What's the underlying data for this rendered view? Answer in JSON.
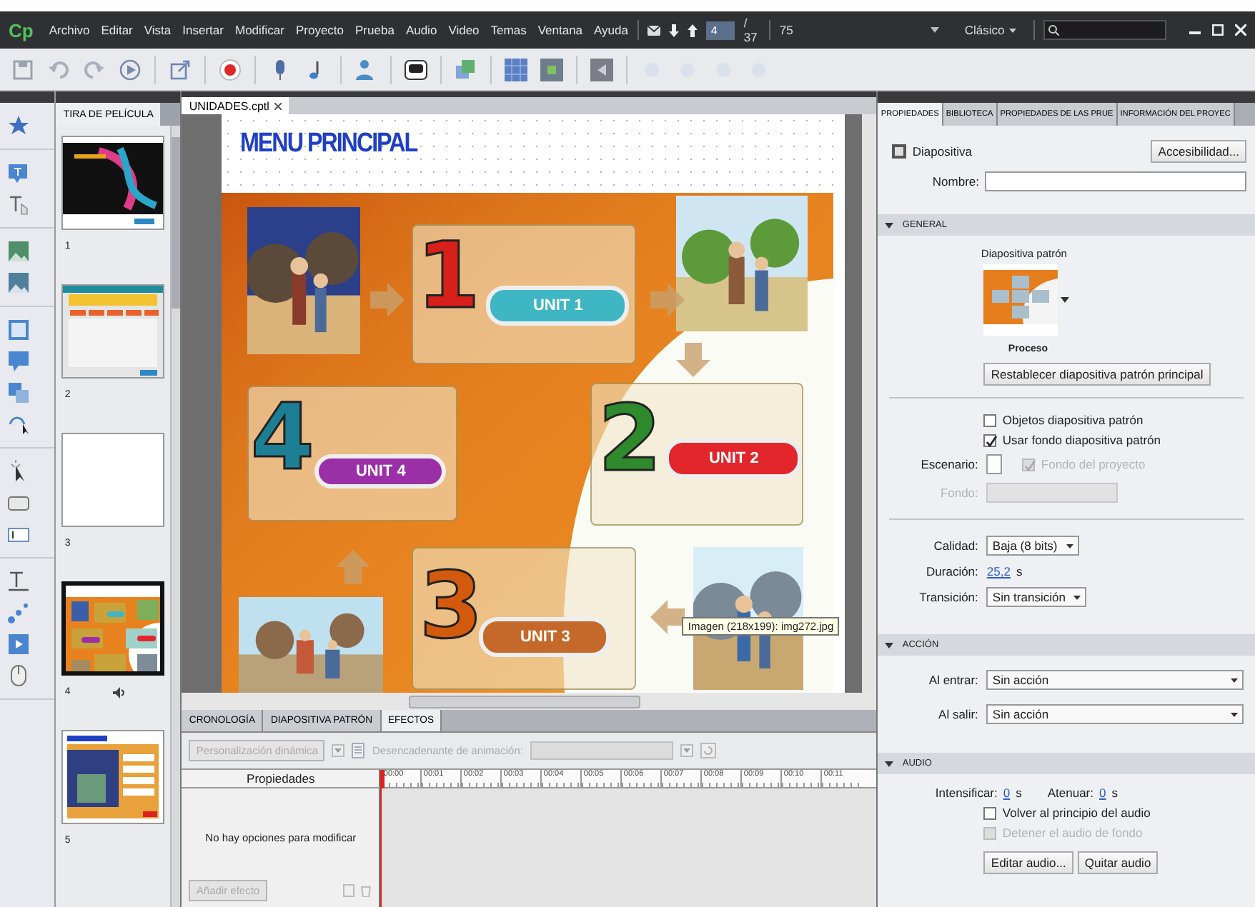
{
  "app": {
    "logo": "Cp"
  },
  "menu": [
    {
      "label": "Archivo"
    },
    {
      "label": "Editar"
    },
    {
      "label": "Vista"
    },
    {
      "label": "Insertar"
    },
    {
      "label": "Modificar"
    },
    {
      "label": "Proyecto"
    },
    {
      "label": "Prueba"
    },
    {
      "label": "Audio"
    },
    {
      "label": "Video"
    },
    {
      "label": "Temas"
    },
    {
      "label": "Ventana"
    },
    {
      "label": "Ayuda"
    }
  ],
  "navigation": {
    "slide": "4",
    "total": "/ 37",
    "zoom": "75"
  },
  "workspace": {
    "label": "Clásico"
  },
  "filmstrip": {
    "title": "TIRA DE PELÍCULA",
    "slides": [
      {
        "number": "1",
        "kind": "dark",
        "selected": false,
        "audio": false
      },
      {
        "number": "2",
        "kind": "menu",
        "selected": false,
        "audio": false
      },
      {
        "number": "3",
        "kind": "blank",
        "selected": false,
        "audio": false
      },
      {
        "number": "4",
        "kind": "units",
        "selected": true,
        "audio": true
      },
      {
        "number": "5",
        "kind": "unit-page",
        "selected": false,
        "audio": false
      }
    ]
  },
  "document_tab": {
    "label": "UNIDADES.cptl"
  },
  "slide": {
    "title": "MENU PRINCIPAL",
    "units": [
      {
        "label": "UNIT 1",
        "number": "1",
        "color": "#3eb6c4"
      },
      {
        "label": "UNIT 4",
        "number": "4",
        "color": "#9a2fa8"
      },
      {
        "label": "UNIT 2",
        "number": "2",
        "color": "#e3262c"
      },
      {
        "label": "UNIT 3",
        "number": "3",
        "color": "#c5692a"
      }
    ],
    "tooltip": "Imagen (218x199): img272.jpg"
  },
  "bottom_panel": {
    "tabs": [
      {
        "label": "CRONOLOGÍA",
        "selected": false
      },
      {
        "label": "DIAPOSITIVA PATRÓN",
        "selected": false
      },
      {
        "label": "EFECTOS",
        "selected": true
      }
    ],
    "custom_button": {
      "label": "Personalización dinámica",
      "disabled": true
    },
    "trigger_label": {
      "label": "Desencadenante de animación:",
      "disabled": true
    },
    "properties_header": "Propiedades",
    "empty_message": "No hay opciones para modificar",
    "add_effect": {
      "label": "Añadir efecto",
      "disabled": true
    },
    "ticks": [
      "00:00",
      "00:01",
      "00:02",
      "00:03",
      "00:04",
      "00:05",
      "00:06",
      "00:07",
      "00:08",
      "00:09",
      "00:10",
      "00:11"
    ]
  },
  "properties": {
    "tabs": [
      {
        "label": "PROPIEDADES",
        "selected": true
      },
      {
        "label": "BIBLIOTECA",
        "selected": false
      },
      {
        "label": "PROPIEDADES DE LAS PRUE",
        "selected": false
      },
      {
        "label": "INFORMACIÓN DEL PROYEC",
        "selected": false
      }
    ],
    "object_type": "Diapositiva",
    "accessibility_button": "Accesibilidad...",
    "name_label": "Nombre:",
    "sections": [
      {
        "title": "GENERAL",
        "expanded": true,
        "master_label": "Diapositiva patrón",
        "master_name": "Proceso",
        "reset_button": "Restablecer diapositiva patrón principal",
        "checkboxes": [
          {
            "label": "Objetos diapositiva patrón",
            "checked": false,
            "disabled": false
          },
          {
            "label": "Usar fondo diapositiva patrón",
            "checked": true,
            "disabled": false
          }
        ],
        "stage_label": "Escenario:",
        "project_bg": {
          "label": "Fondo del proyecto",
          "checked": true,
          "disabled": true
        },
        "background_label": "Fondo:",
        "quality_label": "Calidad:",
        "quality": "Baja (8 bits)",
        "duration_label": "Duración:",
        "duration": "25,2",
        "duration_unit": "s",
        "transition_label": "Transición:",
        "transition": "Sin transición"
      },
      {
        "title": "ACCIÓN",
        "expanded": true,
        "fields": [
          {
            "label": "Al entrar:",
            "value": "Sin acción"
          },
          {
            "label": "Al salir:",
            "value": "Sin acción"
          }
        ]
      },
      {
        "title": "AUDIO",
        "expanded": true,
        "fade_in_label": "Intensificar:",
        "fade_in": "0",
        "fade_in_unit": "s",
        "fade_out_label": "Atenuar:",
        "fade_out": "0",
        "fade_out_unit": "s",
        "checkboxes": [
          {
            "label": "Volver al principio del audio",
            "checked": false,
            "disabled": false
          },
          {
            "label": "Detener el audio de fondo",
            "checked": false,
            "disabled": true
          }
        ],
        "buttons": [
          "Editar audio...",
          "Quitar audio"
        ]
      }
    ]
  }
}
